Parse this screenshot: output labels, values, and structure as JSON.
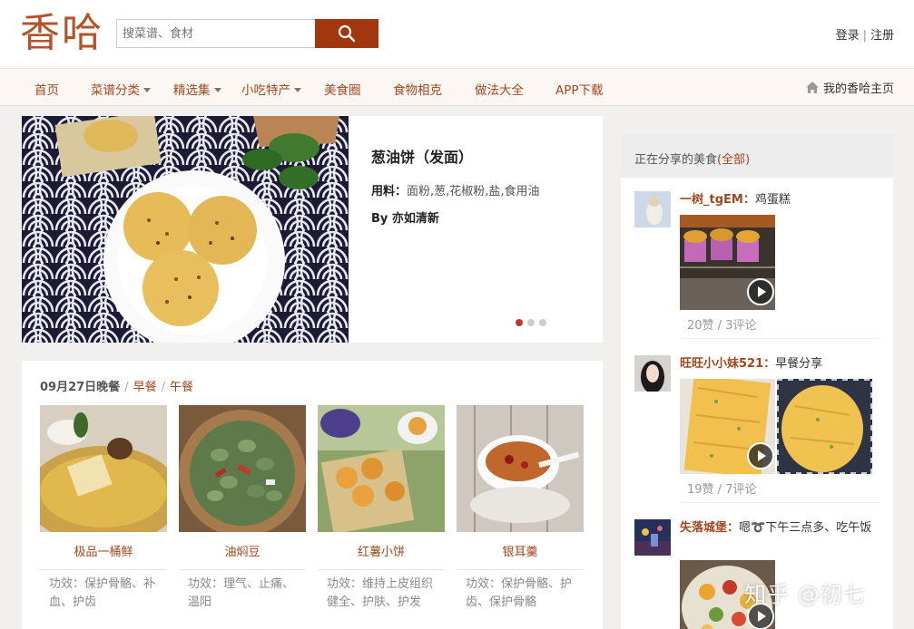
{
  "header": {
    "logo": "香哈",
    "search_placeholder": "搜菜谱、食材",
    "login": "登录",
    "separator": "|",
    "register": "注册"
  },
  "nav": {
    "items": [
      {
        "label": "首页",
        "dropdown": false
      },
      {
        "label": "菜谱分类",
        "dropdown": true
      },
      {
        "label": "精选集",
        "dropdown": true
      },
      {
        "label": "小吃特产",
        "dropdown": true
      },
      {
        "label": "美食圈",
        "dropdown": false
      },
      {
        "label": "食物相克",
        "dropdown": false
      },
      {
        "label": "做法大全",
        "dropdown": false
      },
      {
        "label": "APP下载",
        "dropdown": false
      }
    ],
    "home_link": "我的香哈主页"
  },
  "hero": {
    "title": "葱油饼（发面）",
    "ingredients_label": "用料：",
    "ingredients": "面粉,葱,花椒粉,盐,食用油",
    "author": "By 亦如清新",
    "slide_count": 3,
    "active_slide": 1
  },
  "meals": {
    "date": "09月27日晚餐",
    "tabs": [
      "早餐",
      "午餐"
    ],
    "cards": [
      {
        "name": "极品一桶鲜",
        "effect": "功效：保护骨骼、补血、护齿"
      },
      {
        "name": "油焖豆",
        "effect": "功效：理气、止痛、温阳"
      },
      {
        "name": "红薯小饼",
        "effect": "功效：维持上皮组织健全、护肤、护发"
      },
      {
        "name": "银耳羹",
        "effect": "功效：保护骨骼、护齿、保护骨骼"
      }
    ]
  },
  "sidebar": {
    "title": "正在分享的美食",
    "all_link": "(全部)",
    "feed": [
      {
        "user": "一树_tgEM：",
        "text": "鸡蛋糕",
        "stats": "20赞 / 3评论"
      },
      {
        "user": "旺旺小小妹521：",
        "text": "早餐分享",
        "stats": "19赞 / 7评论"
      },
      {
        "user": "失落城堡：",
        "text": "嗯➰下午三点多、吃午饭",
        "stats": ""
      }
    ]
  },
  "watermark": "知乎 @初七",
  "colors": {
    "brand": "#b4532a",
    "search_button": "#a2360f",
    "link": "#a0471d",
    "active_dot": "#c0392b"
  }
}
